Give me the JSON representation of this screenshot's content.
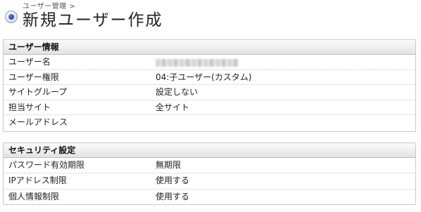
{
  "header": {
    "breadcrumb": "ユーザー管理 >",
    "title": "新規ユーザー作成"
  },
  "sections": [
    {
      "title": "ユーザー情報",
      "rows": [
        {
          "label": "ユーザー名",
          "value": "",
          "redacted": true
        },
        {
          "label": "ユーザー権限",
          "value": "04:子ユーザー(カスタム)"
        },
        {
          "label": "サイトグループ",
          "value": "設定しない"
        },
        {
          "label": "担当サイト",
          "value": "全サイト"
        },
        {
          "label": "メールアドレス",
          "value": ""
        }
      ]
    },
    {
      "title": "セキュリティ設定",
      "rows": [
        {
          "label": "パスワード有効期限",
          "value": "無期限"
        },
        {
          "label": "IPアドレス制限",
          "value": "使用する"
        },
        {
          "label": "個人情報制限",
          "value": "使用する"
        }
      ]
    }
  ],
  "colors": {
    "section_border": "#c9c9c9",
    "header_gradient_top": "#fbfbfb",
    "header_gradient_bottom": "#e2e2e2",
    "icon_blue": "#2c3f9e"
  },
  "icons": {
    "title_icon": "radio-bullet-icon"
  }
}
